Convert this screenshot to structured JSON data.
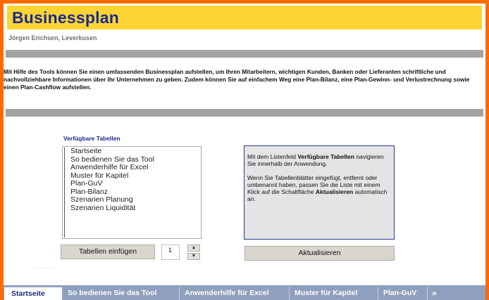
{
  "header": {
    "title": "Businessplan",
    "author": "Jörgen Erichsen, Leverkusen"
  },
  "intro": {
    "text": "Mit Hilfe des Tools können Sie einen umfassenden Businessplan aufstellen, um Ihren Mitarbeitern, wichtigen Kunden, Banken oder Lieferanten schriftliche und nachvollziehbare Informationen über Ihr Unternehmen zu geben. Zudem können Sie auf einfachem Weg eine Plan-Bilanz, eine Plan-Gewinn- und Verlustrechnung sowie einen Plan-Cashflow aufstellen."
  },
  "tables": {
    "label": "Verfügbare Tabellen",
    "items": [
      "Startseite",
      "So bedienen Sie das Tool",
      "Anwenderhilfe für Excel",
      "Muster für Kapitel",
      "Plan-GuV",
      "Plan-Bilanz",
      "Szenarien Planung",
      "Szenarien Liquidität"
    ],
    "insert_button": "Tabellen einfügen",
    "count_value": "1"
  },
  "info": {
    "p1_a": "Mit dem Listenfeld ",
    "p1_bold": "Verfügbare Tabellen",
    "p1_b": " navigieren Sie innerhalb der Anwendung.",
    "p2_a": "Wenn Sie Tabellenblätter eingefügt, entfernt oder umbenannt haben, passen Sie die Liste mit einem Klick auf die Schaltfläche ",
    "p2_bold": "Aktualisieren",
    "p2_b": " automatisch an.",
    "refresh_button": "Aktualisieren"
  },
  "sheet_tabs": [
    "Startseite",
    "So bedienen Sie das Tool",
    "Anwenderhilfe für Excel",
    "Muster für Kapitel",
    "Plan-GuV"
  ],
  "sheet_tabs_more": "»",
  "colors": {
    "frame": "#ff6a00",
    "title_bar": "#fcd535",
    "title_text": "#1b2a8c",
    "tab_strip": "#8f9fbe"
  },
  "icons": {
    "spin_up": "▲",
    "spin_down": "▼"
  }
}
